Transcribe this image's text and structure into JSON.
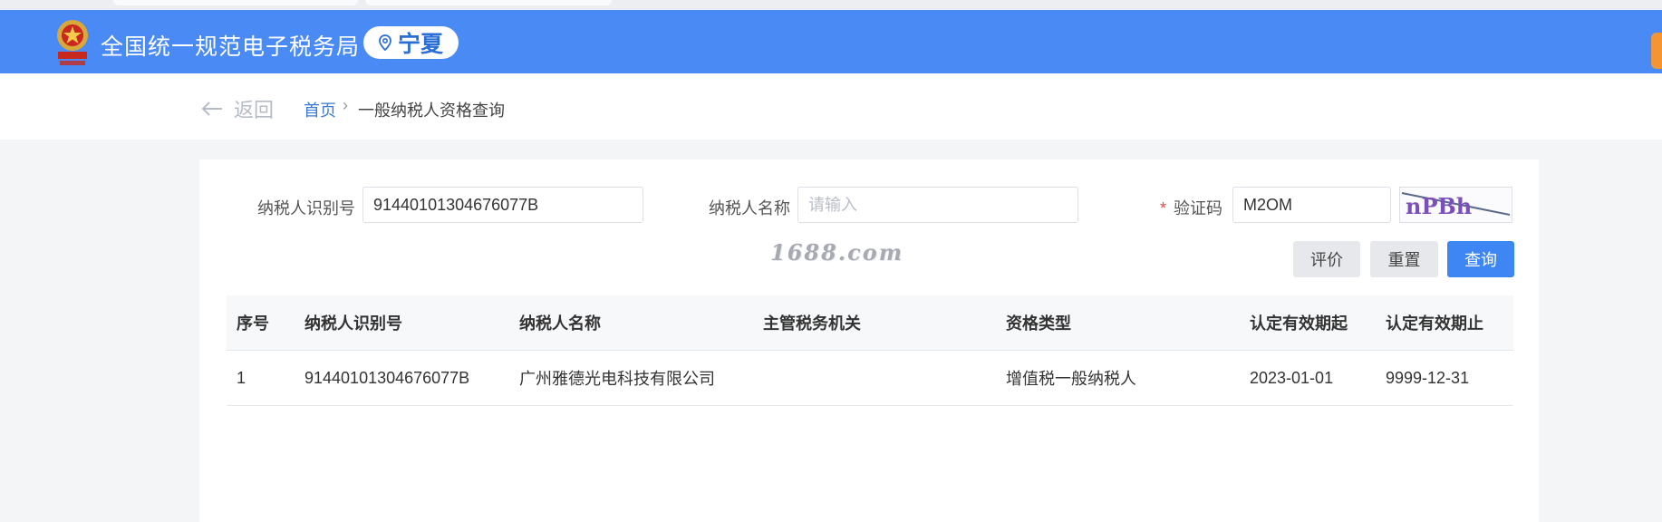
{
  "header": {
    "site_title": "全国统一规范电子税务局",
    "region": "宁夏",
    "emblem_icon": "national-tax-emblem-icon",
    "location_icon": "location-pin-icon"
  },
  "breadcrumb": {
    "back_label": "返回",
    "home": "首页",
    "separator": "›",
    "current": "一般纳税人资格查询"
  },
  "form": {
    "taxpayer_id_label": "纳税人识别号",
    "taxpayer_id_value": "91440101304676077B",
    "taxpayer_name_label": "纳税人名称",
    "taxpayer_name_placeholder": "请输入",
    "captcha_required_mark": "*",
    "captcha_label": "验证码",
    "captcha_value": "M2OM",
    "captcha_image_text": "nPBh"
  },
  "watermark": "1688.com",
  "buttons": {
    "evaluate": "评价",
    "reset": "重置",
    "query": "查询"
  },
  "table": {
    "columns": [
      "序号",
      "纳税人识别号",
      "纳税人名称",
      "主管税务机关",
      "资格类型",
      "认定有效期起",
      "认定有效期止"
    ],
    "rows": [
      [
        "1",
        "91440101304676077B",
        "广州雅德光电科技有限公司",
        "",
        "增值税一般纳税人",
        "2023-01-01",
        "9999-12-31"
      ]
    ]
  },
  "colors": {
    "header_bg": "#4a8af4",
    "primary_button": "#3e86f4",
    "link": "#3a7bd5",
    "required": "#e5484d"
  }
}
